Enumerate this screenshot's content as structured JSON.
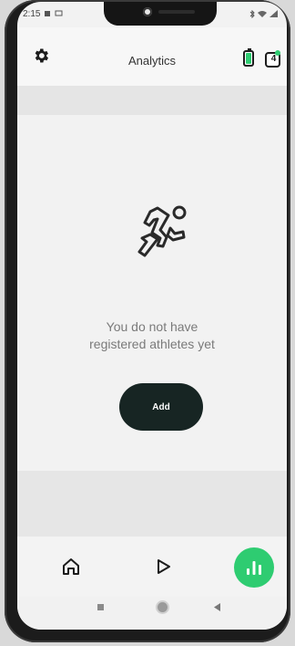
{
  "status_bar": {
    "time": "2:15",
    "left_icons": [
      "sim-icon",
      "message-icon"
    ],
    "right_icons": [
      "bluetooth-icon",
      "wifi-icon",
      "signal-icon"
    ]
  },
  "header": {
    "title": "Analytics",
    "notification_count": "4",
    "icons": [
      "settings-icon",
      "battery-icon",
      "notification-icon"
    ]
  },
  "empty_state": {
    "icon": "runner-icon",
    "message_line1": "You do not have",
    "message_line2": "registered athletes yet",
    "add_label": "Add"
  },
  "bottom_nav": {
    "items": [
      "home-icon",
      "play-icon",
      "analytics-icon"
    ],
    "active": "analytics"
  },
  "colors": {
    "accent": "#2ecc71",
    "button": "#172523",
    "background": "#f2f2f2"
  }
}
